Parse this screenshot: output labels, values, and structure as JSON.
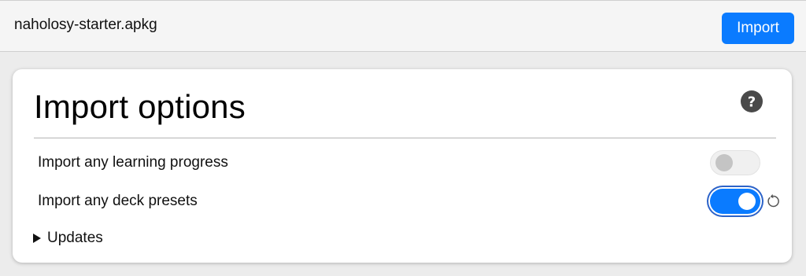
{
  "top_bar": {
    "file_name": "naholosy-starter.apkg",
    "import_button_label": "Import"
  },
  "card": {
    "title": "Import options",
    "help_icon": "question-circle-icon",
    "options": [
      {
        "label": "Import any learning progress",
        "enabled": false
      },
      {
        "label": "Import any deck presets",
        "enabled": true,
        "revert_icon": "revert-icon"
      }
    ],
    "updates_label": "Updates"
  },
  "colors": {
    "accent": "#0a7bff",
    "toggle_off": "#f0f0f0",
    "page_bg": "#ececec"
  }
}
